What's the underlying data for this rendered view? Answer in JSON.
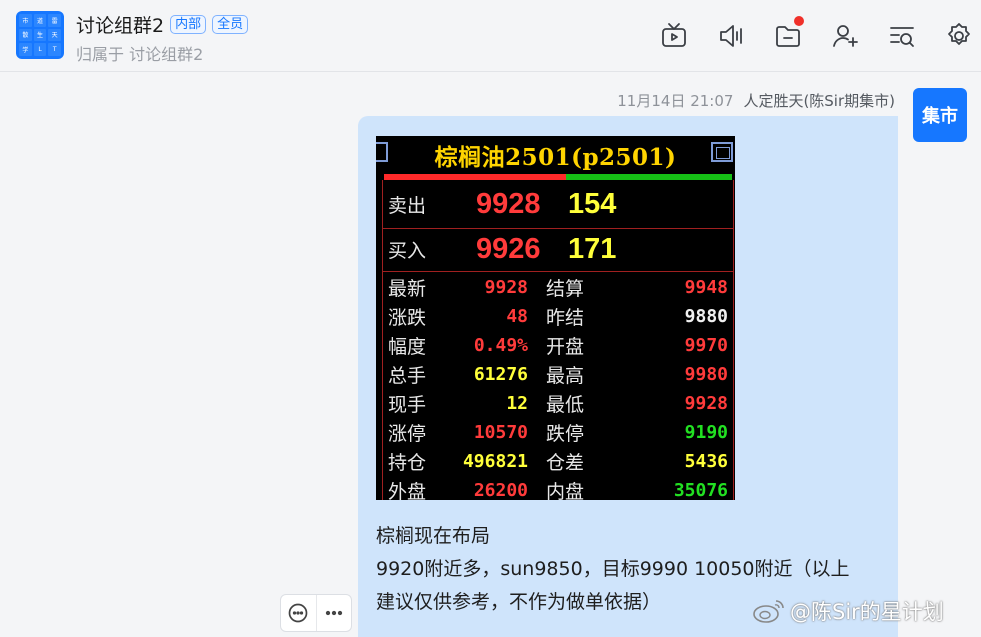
{
  "header": {
    "avatar_chars": [
      "市",
      "道",
      "雷",
      "散",
      "生",
      "天",
      "学",
      "L",
      "T"
    ],
    "title": "讨论组群2",
    "tags": [
      "内部",
      "全员"
    ],
    "subtitle": "归属于 讨论组群2",
    "icons": [
      "tv-icon",
      "speaker-icon",
      "folder-icon",
      "add-user-icon",
      "search-list-icon",
      "gear-icon"
    ]
  },
  "message": {
    "timestamp": "11月14日 21:07",
    "sender": "人定胜天(陈Sir期集市)",
    "avatar_text": "集市",
    "text_lines": [
      "棕榈现在布局",
      "9920附近多，sun9850，目标9990 10050附近（以上",
      "建议仅供参考，不作为做单依据）"
    ]
  },
  "quote": {
    "title": "棕榈油2501(p2501)",
    "sell": {
      "label": "卖出",
      "price": "9928",
      "volume": "154"
    },
    "buy": {
      "label": "买入",
      "price": "9926",
      "volume": "171"
    },
    "rows": [
      {
        "k1": "最新",
        "v1": "9928",
        "c1": "#ff3b3b",
        "k2": "结算",
        "v2": "9948",
        "c2": "#ff3b3b"
      },
      {
        "k1": "涨跌",
        "v1": "48",
        "c1": "#ff3b3b",
        "k2": "昨结",
        "v2": "9880",
        "c2": "#f0f0f0"
      },
      {
        "k1": "幅度",
        "v1": "0.49%",
        "c1": "#ff3b3b",
        "k2": "开盘",
        "v2": "9970",
        "c2": "#ff3b3b"
      },
      {
        "k1": "总手",
        "v1": "61276",
        "c1": "#ffff3a",
        "k2": "最高",
        "v2": "9980",
        "c2": "#ff3b3b"
      },
      {
        "k1": "现手",
        "v1": "12",
        "c1": "#ffff3a",
        "k2": "最低",
        "v2": "9928",
        "c2": "#ff3b3b"
      },
      {
        "k1": "涨停",
        "v1": "10570",
        "c1": "#ff3b3b",
        "k2": "跌停",
        "v2": "9190",
        "c2": "#22e022"
      },
      {
        "k1": "持仓",
        "v1": "496821",
        "c1": "#ffff3a",
        "k2": "仓差",
        "v2": "5436",
        "c2": "#ffff3a"
      },
      {
        "k1": "外盘",
        "v1": "26200",
        "c1": "#ff3b3b",
        "k2": "内盘",
        "v2": "35076",
        "c2": "#22e022"
      }
    ]
  },
  "actions": [
    "comment-icon",
    "more-icon"
  ],
  "watermark": "@陈Sir的星计划",
  "colors": {
    "accent": "#1677ff",
    "bubble": "#cfe4fb",
    "notify": "#f0302a"
  }
}
